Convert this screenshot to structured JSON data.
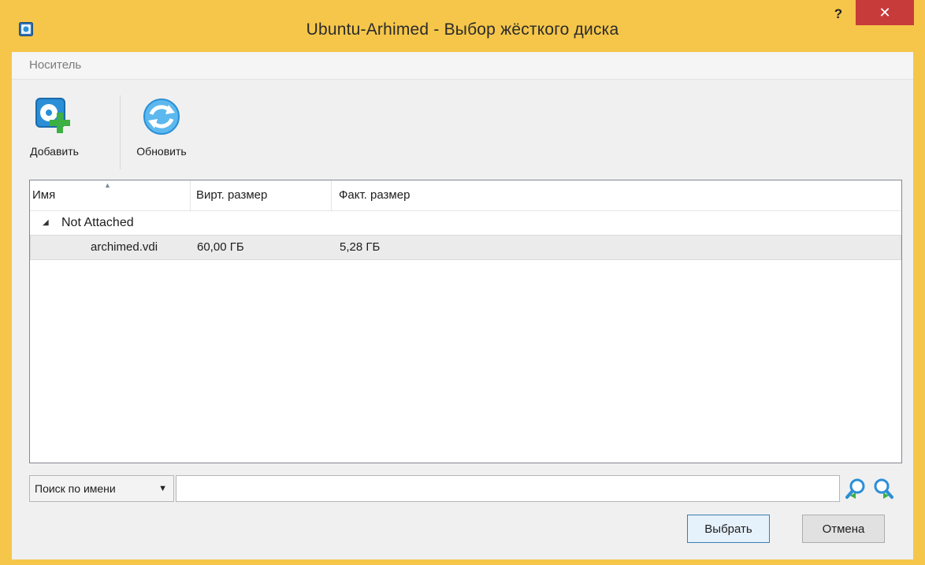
{
  "window": {
    "title": "Ubuntu-Arhimed - Выбор жёсткого диска",
    "help_label": "?",
    "close_label": "✕"
  },
  "menu": {
    "items": [
      "Носитель"
    ]
  },
  "toolbar": {
    "add_label": "Добавить",
    "refresh_label": "Обновить"
  },
  "table": {
    "columns": [
      "Имя",
      "Вирт. размер",
      "Факт. размер"
    ],
    "sort_indicator": "▲",
    "groups": [
      {
        "label": "Not Attached",
        "expander": "◢",
        "rows": [
          {
            "name": "archimed.vdi",
            "virtual_size": "60,00 ГБ",
            "actual_size": "5,28 ГБ"
          }
        ]
      }
    ]
  },
  "search": {
    "mode": "Поиск по имени",
    "dropdown_glyph": "▼",
    "value": ""
  },
  "buttons": {
    "select": "Выбрать",
    "cancel": "Отмена"
  },
  "colors": {
    "titlebar": "#f5c64a",
    "close_button": "#c73b3b",
    "icon_blue": "#2a8fd6",
    "icon_green": "#3cb043"
  },
  "icons": {
    "app": "virtualbox-icon",
    "add": "add-disk-icon",
    "refresh": "refresh-icon",
    "find_prev": "find-previous-icon",
    "find_next": "find-next-icon"
  }
}
